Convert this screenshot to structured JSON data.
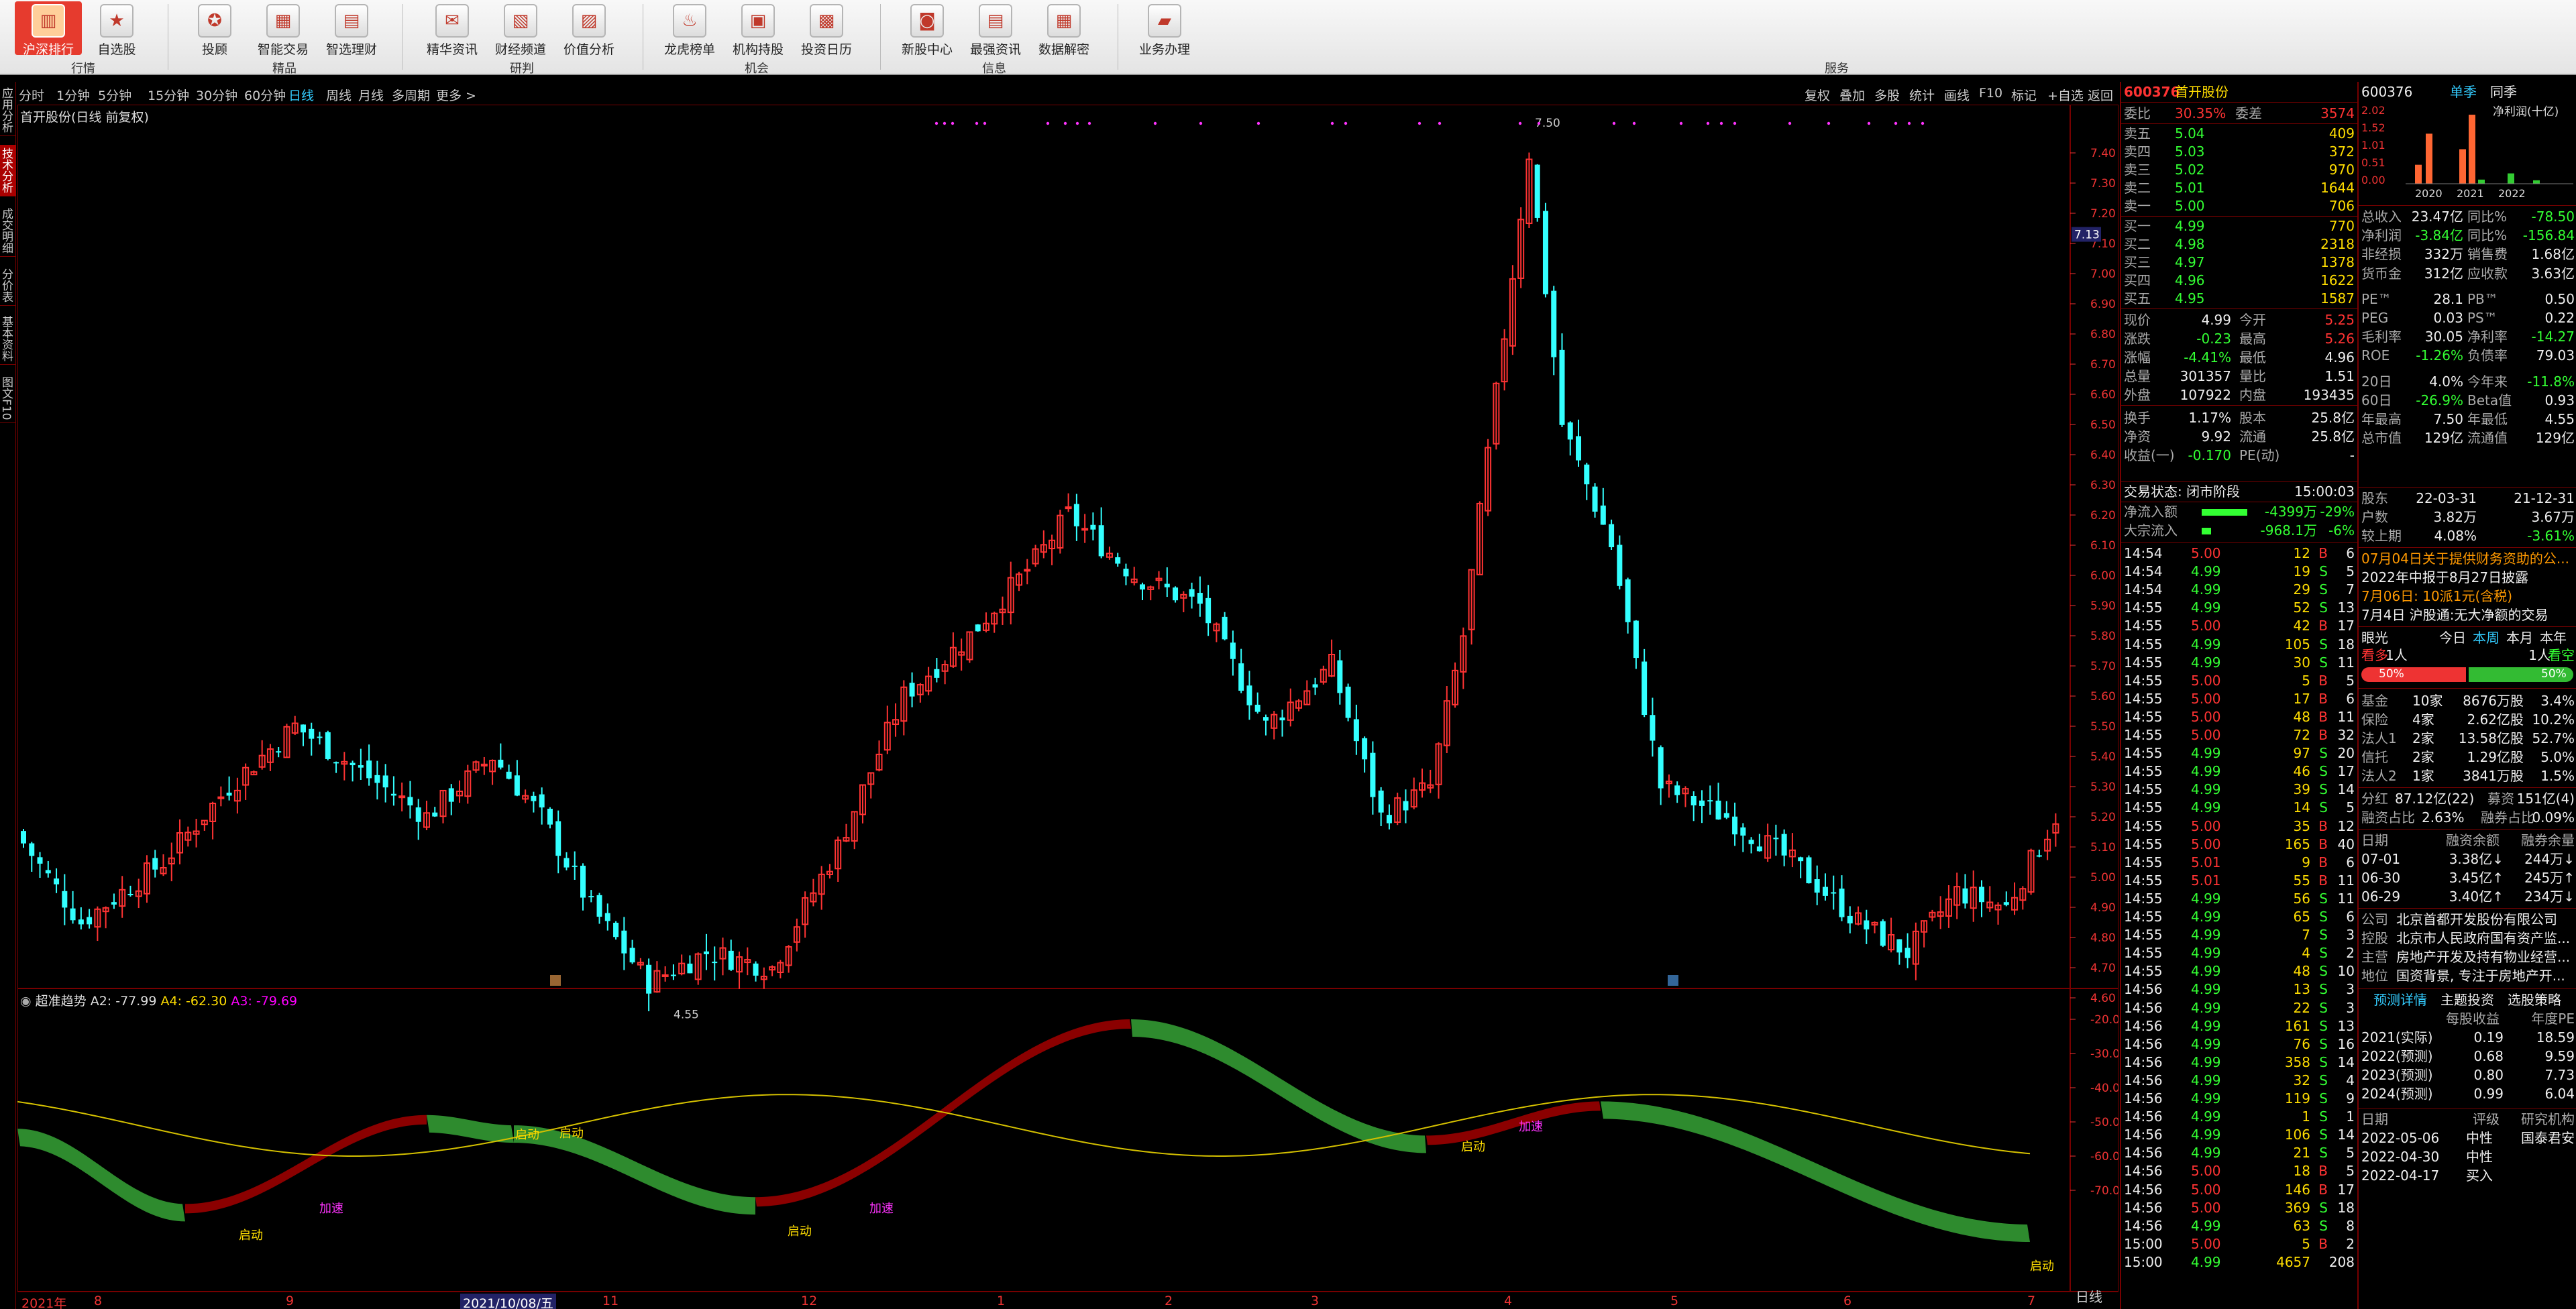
{
  "toolbar": {
    "items": [
      {
        "label": "沪深排行",
        "icon": "ranking-icon",
        "active": true
      },
      {
        "label": "自选股",
        "icon": "star-icon"
      },
      {
        "label": "投顾",
        "icon": "advisor-icon"
      },
      {
        "label": "智能交易",
        "icon": "smart-trade-icon"
      },
      {
        "label": "智选理财",
        "icon": "finance-icon"
      },
      {
        "label": "精华资讯",
        "icon": "news-icon"
      },
      {
        "label": "财经频道",
        "icon": "channel-icon"
      },
      {
        "label": "价值分析",
        "icon": "analysis-icon"
      },
      {
        "label": "龙虎榜单",
        "icon": "dragon-tiger-icon"
      },
      {
        "label": "机构持股",
        "icon": "institution-icon"
      },
      {
        "label": "投资日历",
        "icon": "calendar-icon"
      },
      {
        "label": "新股中心",
        "icon": "ipo-icon"
      },
      {
        "label": "最强资讯",
        "icon": "hot-news-icon"
      },
      {
        "label": "数据解密",
        "icon": "data-icon"
      },
      {
        "label": "业务办理",
        "icon": "briefcase-icon"
      }
    ],
    "groups": [
      "行情",
      "精品",
      "研判",
      "机会",
      "信息",
      "服务"
    ]
  },
  "period_bar": [
    "分时",
    "1分钟",
    "5分钟",
    "15分钟",
    "30分钟",
    "60分钟",
    "日线",
    "周线",
    "月线",
    "多周期",
    "更多 >"
  ],
  "period_selected": "日线",
  "right_tools": [
    "复权",
    "叠加",
    "多股",
    "统计",
    "画线",
    "F10",
    "标记",
    "+自选",
    "返回"
  ],
  "left_tabs": [
    "应用分析",
    "技术分析",
    "成交明细",
    "分价表",
    "基本资料",
    "图文F10"
  ],
  "left_tab_active": "技术分析",
  "chart": {
    "title": "首开股份(日线 前复权)",
    "price_high_label": "7.50",
    "price_low_label": "4.55",
    "current_price_tag": "7.13",
    "y_ticks": [
      "7.40",
      "7.30",
      "7.20",
      "7.10",
      "7.00",
      "6.90",
      "6.80",
      "6.70",
      "6.60",
      "6.50",
      "6.40",
      "6.30",
      "6.20",
      "6.10",
      "6.00",
      "5.90",
      "5.80",
      "5.70",
      "5.60",
      "5.50",
      "5.40",
      "5.30",
      "5.20",
      "5.10",
      "5.00",
      "4.90",
      "4.80",
      "4.70",
      "4.60"
    ],
    "indicator_title": "超准趋势",
    "indicator_a2": "A2: -77.99",
    "indicator_a4": "A4: -62.30",
    "indicator_a3": "A3: -79.69",
    "ind_ticks": [
      "-20.00",
      "-30.00",
      "-40.00",
      "-50.00",
      "-60.00",
      "-70.00"
    ],
    "x_labels": [
      "2021年",
      "8",
      "9",
      "2021/10/08/五",
      "11",
      "12",
      "1",
      "2",
      "3",
      "4",
      "5",
      "6",
      "7"
    ],
    "day_label": "日线",
    "annotations": [
      "启动",
      "加速",
      "启动",
      "启动",
      "启动",
      "加速",
      "启动",
      "加速",
      "启动"
    ]
  },
  "quote": {
    "code": "600376",
    "name": "首开股份",
    "weibi_label": "委比",
    "weibi": "30.35%",
    "weicha_label": "委差",
    "weicha": "3574",
    "asks": [
      [
        "卖五",
        "5.04",
        "409"
      ],
      [
        "卖四",
        "5.03",
        "372"
      ],
      [
        "卖三",
        "5.02",
        "970"
      ],
      [
        "卖二",
        "5.01",
        "1644"
      ],
      [
        "卖一",
        "5.00",
        "706"
      ]
    ],
    "bids": [
      [
        "买一",
        "4.99",
        "770"
      ],
      [
        "买二",
        "4.98",
        "2318"
      ],
      [
        "买三",
        "4.97",
        "1378"
      ],
      [
        "买四",
        "4.96",
        "1622"
      ],
      [
        "买五",
        "4.95",
        "1587"
      ]
    ],
    "stats": [
      [
        "现价",
        "4.99",
        "今开",
        "5.25"
      ],
      [
        "涨跌",
        "-0.23",
        "最高",
        "5.26"
      ],
      [
        "涨幅",
        "-4.41%",
        "最低",
        "4.96"
      ],
      [
        "总量",
        "301357",
        "量比",
        "1.51"
      ],
      [
        "外盘",
        "107922",
        "内盘",
        "193435"
      ],
      [
        "换手",
        "1.17%",
        "股本",
        "25.8亿"
      ],
      [
        "净资",
        "9.92",
        "流通",
        "25.8亿"
      ],
      [
        "收益(一)",
        "-0.170",
        "PE(动)",
        "-"
      ]
    ],
    "trade_status": "交易状态: 闭市阶段",
    "trade_time": "15:00:03",
    "netflow": [
      "净流入额",
      "-4399万",
      "-29%"
    ],
    "bigflow": [
      "大宗流入",
      "-968.1万",
      "-6%"
    ],
    "ticks": [
      [
        "14:54",
        "5.00",
        "12",
        "B",
        "6"
      ],
      [
        "14:54",
        "4.99",
        "19",
        "S",
        "5"
      ],
      [
        "14:54",
        "4.99",
        "29",
        "S",
        "7"
      ],
      [
        "14:55",
        "4.99",
        "52",
        "S",
        "13"
      ],
      [
        "14:55",
        "5.00",
        "42",
        "B",
        "17"
      ],
      [
        "14:55",
        "4.99",
        "105",
        "S",
        "18"
      ],
      [
        "14:55",
        "4.99",
        "30",
        "S",
        "11"
      ],
      [
        "14:55",
        "5.00",
        "5",
        "B",
        "5"
      ],
      [
        "14:55",
        "5.00",
        "17",
        "B",
        "6"
      ],
      [
        "14:55",
        "5.00",
        "48",
        "B",
        "11"
      ],
      [
        "14:55",
        "5.00",
        "72",
        "B",
        "32"
      ],
      [
        "14:55",
        "4.99",
        "97",
        "S",
        "20"
      ],
      [
        "14:55",
        "4.99",
        "46",
        "S",
        "17"
      ],
      [
        "14:55",
        "4.99",
        "39",
        "S",
        "14"
      ],
      [
        "14:55",
        "4.99",
        "14",
        "S",
        "5"
      ],
      [
        "14:55",
        "5.00",
        "35",
        "B",
        "12"
      ],
      [
        "14:55",
        "5.00",
        "165",
        "B",
        "40"
      ],
      [
        "14:55",
        "5.01",
        "9",
        "B",
        "6"
      ],
      [
        "14:55",
        "5.01",
        "55",
        "B",
        "11"
      ],
      [
        "14:55",
        "4.99",
        "56",
        "S",
        "11"
      ],
      [
        "14:55",
        "4.99",
        "65",
        "S",
        "6"
      ],
      [
        "14:55",
        "4.99",
        "7",
        "S",
        "3"
      ],
      [
        "14:55",
        "4.99",
        "4",
        "S",
        "2"
      ],
      [
        "14:55",
        "4.99",
        "48",
        "S",
        "10"
      ],
      [
        "14:56",
        "4.99",
        "13",
        "S",
        "3"
      ],
      [
        "14:56",
        "4.99",
        "22",
        "S",
        "3"
      ],
      [
        "14:56",
        "4.99",
        "161",
        "S",
        "13"
      ],
      [
        "14:56",
        "4.99",
        "76",
        "S",
        "16"
      ],
      [
        "14:56",
        "4.99",
        "358",
        "S",
        "14"
      ],
      [
        "14:56",
        "4.99",
        "32",
        "S",
        "4"
      ],
      [
        "14:56",
        "4.99",
        "119",
        "S",
        "9"
      ],
      [
        "14:56",
        "4.99",
        "1",
        "S",
        "1"
      ],
      [
        "14:56",
        "4.99",
        "106",
        "S",
        "14"
      ],
      [
        "14:56",
        "4.99",
        "21",
        "S",
        "5"
      ],
      [
        "14:56",
        "5.00",
        "18",
        "B",
        "5"
      ],
      [
        "14:56",
        "5.00",
        "146",
        "B",
        "17"
      ],
      [
        "14:56",
        "5.00",
        "369",
        "S",
        "18"
      ],
      [
        "14:56",
        "4.99",
        "63",
        "S",
        "8"
      ],
      [
        "15:00",
        "5.00",
        "5",
        "B",
        "2"
      ],
      [
        "15:00",
        "4.99",
        "4657",
        "",
        "208"
      ]
    ]
  },
  "fundamentals": {
    "code": "600376",
    "tabs": [
      "单季",
      "同季"
    ],
    "profit_label": "净利润(十亿)",
    "y_ticks": [
      "2.02",
      "1.52",
      "1.01",
      "0.51",
      "0.00"
    ],
    "years": [
      "2020",
      "2021",
      "2022"
    ],
    "chart_data": {
      "type": "bar",
      "categories": [
        "2020",
        "2021",
        "2022"
      ],
      "values": [
        1.45,
        2.0,
        0.3
      ],
      "ylim": [
        0,
        2.02
      ]
    },
    "metrics": [
      [
        "总收入",
        "23.47亿",
        "同比%",
        "-78.50"
      ],
      [
        "净利润",
        "-3.84亿",
        "同比%",
        "-156.84"
      ],
      [
        "非经损",
        "332万",
        "销售费",
        "1.68亿"
      ],
      [
        "货币金",
        "312亿",
        "应收款",
        "3.63亿"
      ],
      [
        "PE™",
        "28.1",
        "PB™",
        "0.50"
      ],
      [
        "PEG",
        "0.03",
        "PS™",
        "0.22"
      ],
      [
        "毛利率",
        "30.05",
        "净利率",
        "-14.27"
      ],
      [
        "ROE",
        "-1.26%",
        "负债率",
        "79.03"
      ],
      [
        "20日",
        "4.0%",
        "今年来",
        "-11.8%"
      ],
      [
        "60日",
        "-26.9%",
        "Beta值",
        "0.93"
      ],
      [
        "年最高",
        "7.50",
        "年最低",
        "4.55"
      ],
      [
        "总市值",
        "129亿",
        "流通值",
        "129亿"
      ]
    ],
    "holders": [
      [
        "股东",
        "22-03-31",
        "21-12-31"
      ],
      [
        "户数",
        "3.82万",
        "3.67万"
      ],
      [
        "较上期",
        "4.08%",
        "-3.61%"
      ]
    ],
    "news": [
      "07月04日关于提供财务资助的公...",
      "2022年中报于8月27日披露",
      "7月06日: 10派1元(含税)",
      "7月4日 沪股通:无大净额的交易"
    ],
    "vote": {
      "label": "眼光",
      "tabs": [
        "今日",
        "本周",
        "本月",
        "本年"
      ],
      "bull": "看多",
      "bull_n": "1人",
      "bear": "看空",
      "bear_n": "1人",
      "bull_pct": "50%",
      "bear_pct": "50%"
    },
    "institutions": [
      [
        "基金",
        "10家",
        "8676万股",
        "3.4%"
      ],
      [
        "保险",
        "4家",
        "2.62亿股",
        "10.2%"
      ],
      [
        "法人1",
        "2家",
        "13.58亿股",
        "52.7%"
      ],
      [
        "信托",
        "2家",
        "1.29亿股",
        "5.0%"
      ],
      [
        "法人2",
        "1家",
        "3841万股",
        "1.5%"
      ]
    ],
    "fenhong": [
      "分红",
      "87.12亿(22)",
      "募资",
      "151亿(4)"
    ],
    "rongzi_ratio": [
      "融资占比",
      "2.63%",
      "融券占比",
      "0.09%"
    ],
    "margin_head": [
      "日期",
      "融资余额",
      "融券余量"
    ],
    "margin": [
      [
        "07-01",
        "3.38亿↓",
        "244万↓"
      ],
      [
        "06-30",
        "3.45亿↑",
        "245万↑"
      ],
      [
        "06-29",
        "3.40亿↑",
        "234万↓"
      ]
    ],
    "company": [
      [
        "公司",
        "北京首都开发股份有限公司"
      ],
      [
        "控股",
        "北京市人民政府国有资产监..."
      ],
      [
        "主营",
        "房地产开发及持有物业经营..."
      ],
      [
        "地位",
        "国资背景, 专注于房地产开..."
      ]
    ],
    "forecast_tabs": [
      "预测详情",
      "主题投资",
      "选股策略"
    ],
    "forecast_head": [
      "",
      "每股收益",
      "年度PE"
    ],
    "forecast": [
      [
        "2021(实际)",
        "0.19",
        "18.59"
      ],
      [
        "2022(预测)",
        "0.68",
        "9.59"
      ],
      [
        "2023(预测)",
        "0.80",
        "7.73"
      ],
      [
        "2024(预测)",
        "0.99",
        "6.04"
      ]
    ],
    "rating_head": [
      "日期",
      "评级",
      "研究机构"
    ],
    "ratings": [
      [
        "2022-05-06",
        "中性",
        "国泰君安"
      ],
      [
        "2022-04-30",
        "中性",
        ""
      ],
      [
        "2022-04-17",
        "买入",
        ""
      ]
    ]
  },
  "colors": {
    "up": "#ff3333",
    "down": "#33ffff",
    "bg": "#000000",
    "grid": "#770000",
    "trend_up": "#8b0000",
    "trend_down": "#2e8b2e",
    "trend_line": "#d4c000"
  }
}
